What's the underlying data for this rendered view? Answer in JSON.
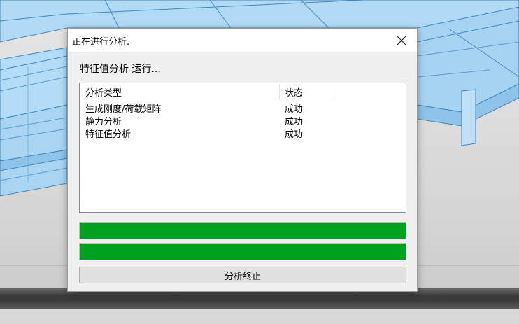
{
  "dialog": {
    "title": "正在进行分析.",
    "status_text": "特征值分析  运行...",
    "table": {
      "headers": [
        "分析类型",
        "状态"
      ],
      "rows": [
        [
          "生成刚度/荷载矩阵",
          "成功"
        ],
        [
          "静力分析",
          "成功"
        ],
        [
          "特征值分析",
          "成功"
        ]
      ]
    },
    "progress_overall": 100,
    "progress_current": 100,
    "stop_button_label": "分析终止"
  },
  "colors": {
    "progress_fill": "#00a020",
    "model_fill": "#a7d3f2",
    "model_line": "#3a7fb5"
  },
  "icons": {
    "close": "close-icon"
  }
}
